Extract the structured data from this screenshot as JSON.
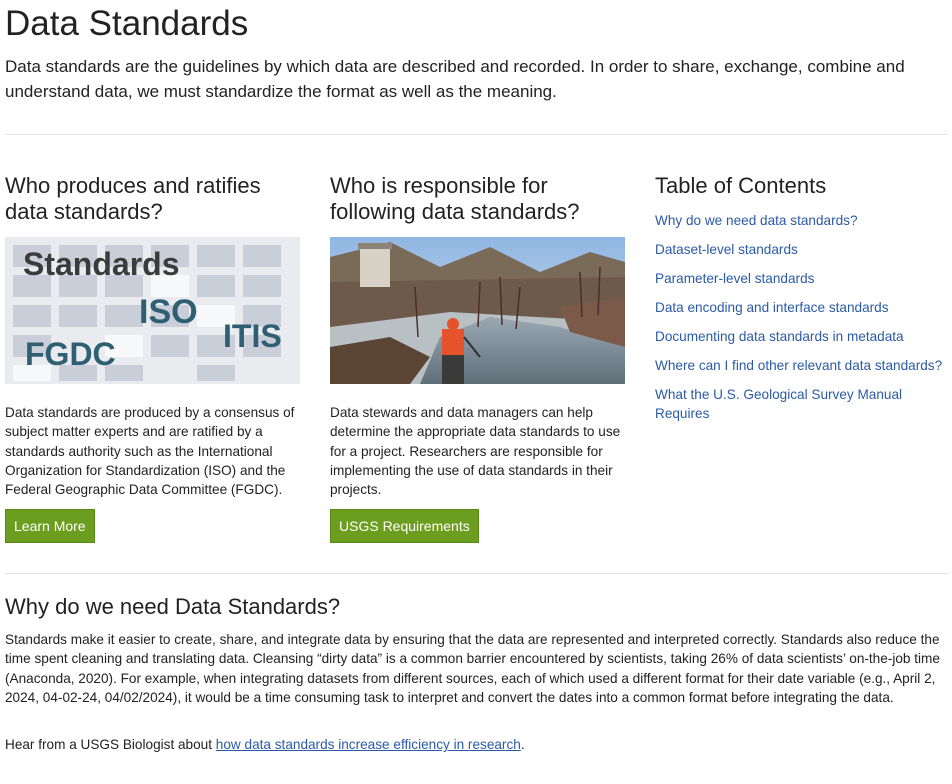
{
  "page": {
    "title": "Data Standards",
    "intro": "Data standards are the guidelines by which data are described and recorded. In order to share, exchange, combine and understand data, we must standardize the format as well as the meaning."
  },
  "col1": {
    "heading": "Who produces and ratifies data standards?",
    "image_labels": {
      "standards": "Standards",
      "iso": "ISO",
      "itis": "ITIS",
      "fgdc": "FGDC"
    },
    "text": "Data standards are produced by a consensus of subject matter experts and are ratified by a standards authority such as the International Organization for Standardization (ISO) and the Federal Geographic Data Committee (FGDC).",
    "button": "Learn More"
  },
  "col2": {
    "heading": "Who is responsible for following data standards?",
    "text": "Data stewards and data managers can help determine the appropriate data standards to use for a project. Researchers are responsible for implementing the use of data standards in their projects.",
    "button": "USGS Requirements"
  },
  "toc": {
    "title": "Table of Contents",
    "items": [
      "Why do we need data standards?",
      "Dataset-level standards",
      "Parameter-level standards",
      "Data encoding and interface standards",
      "Documenting data standards in metadata",
      "Where can I find other relevant data standards?",
      "What the U.S. Geological Survey Manual Requires"
    ]
  },
  "why": {
    "heading": "Why do we need Data Standards?",
    "body": "Standards make it easier to create, share, and integrate data by ensuring that the data are represented and interpreted correctly. Standards also reduce the time spent cleaning and translating data. Cleansing “dirty data” is a common barrier encountered by scientists, taking 26% of data scientists’ on-the-job time (Anaconda, 2020). For example, when integrating datasets from different sources, each of which used a different format for their date variable (e.g., April 2, 2024, 04-02-24, 04/02/2024), it would be a time consuming task to interpret and convert the dates into a common format before integrating the data.",
    "hear_prefix": "Hear from a USGS Biologist about ",
    "hear_link": "how data standards increase efficiency in research",
    "hear_suffix": "."
  },
  "colors": {
    "button_green": "#6b9e1e",
    "link_blue": "#2b5aa6",
    "image_text_dark": "#3b3b3b",
    "image_text_teal": "#2f5f73"
  }
}
